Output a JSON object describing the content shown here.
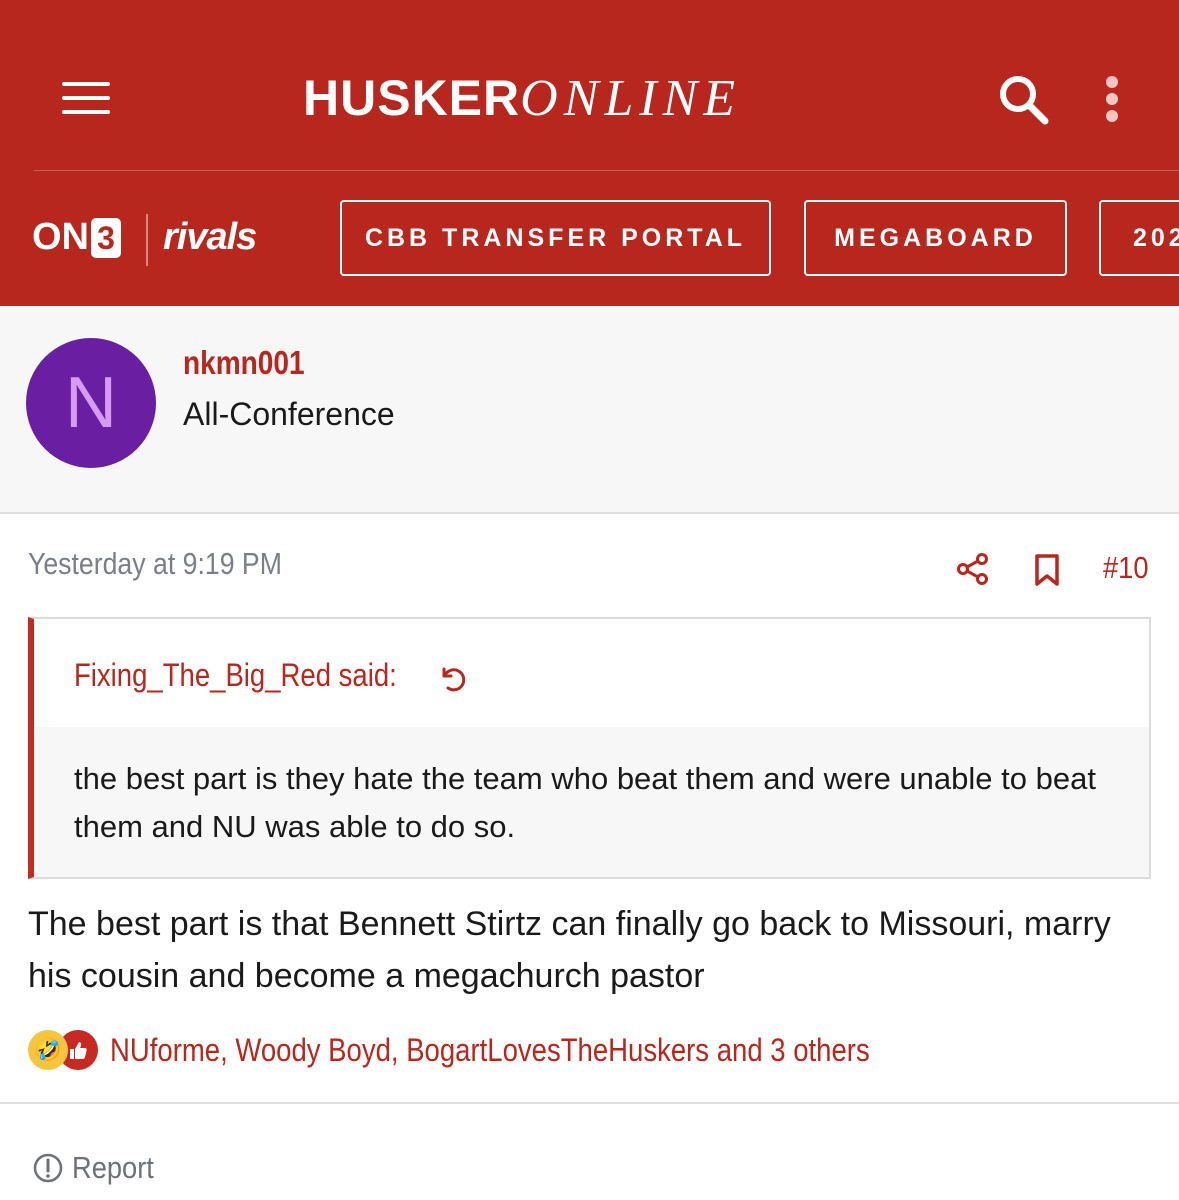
{
  "header": {
    "logo_bold": "HUSKER",
    "logo_light": "ONLINE",
    "brand_on3": "ON",
    "brand_on3_box": "3",
    "brand_rivals": "rivals",
    "nav_buttons": [
      {
        "label": "CBB TRANSFER PORTAL"
      },
      {
        "label": "MEGABOARD"
      },
      {
        "label": "202"
      }
    ]
  },
  "post": {
    "author": {
      "initial": "N",
      "username": "nkmn001",
      "title": "All-Conference"
    },
    "timestamp": "Yesterday at 9:19 PM",
    "post_number": "#10",
    "quote": {
      "author_said": "Fixing_The_Big_Red said:",
      "text": "the best part is they hate the team who beat them and were unable to beat them and NU was able to do so."
    },
    "body": "The best part is that Bennett Stirtz can finally go back to Missouri, marry his cousin and become a megachurch pastor",
    "reactions": {
      "names": "NUforme, Woody Boyd, BogartLovesTheHuskers and 3 others"
    },
    "report_label": "Report"
  },
  "colors": {
    "brand_red": "#b8271d",
    "avatar_purple": "#6a1fa2",
    "muted_gray": "#7a7f87"
  }
}
